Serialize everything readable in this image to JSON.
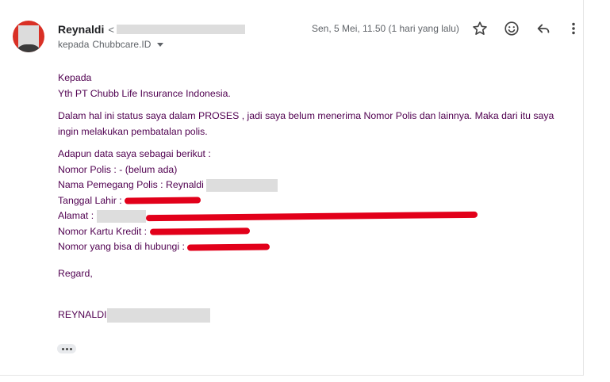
{
  "header": {
    "sender_name": "Reynaldi",
    "sender_email_open": "<",
    "recipient_prefix": "kepada",
    "recipient_name": "Chubbcare.ID",
    "timestamp": "Sen, 5 Mei, 11.50 (1 hari yang lalu)"
  },
  "icons": {
    "star": "star-icon",
    "emoji": "smiley-icon",
    "reply": "reply-icon",
    "more": "more-vert-icon",
    "expand": "ellipsis-icon"
  },
  "body": {
    "greeting_1": "Kepada",
    "greeting_2": "Yth  PT Chubb Life Insurance Indonesia.",
    "paragraph_1_line_1": "Dalam hal ini status saya dalam PROSES , jadi saya belum menerima Nomor Polis dan lainnya. Maka dari itu saya",
    "paragraph_1_line_2": "ingin melakukan pembatalan polis.",
    "data_intro": "Adapun data saya sebagai berikut :",
    "nomor_polis": "Nomor Polis : - (belum ada)",
    "nama_pemegang": "Nama Pemegang Polis : Reynaldi",
    "tanggal_lahir": "Tanggal Lahir :",
    "alamat": "Alamat :",
    "nomor_kartu": "Nomor Kartu Kredit :",
    "nomor_hp": "Nomor yang bisa di hubungi :",
    "closing": "Regard,",
    "signature": "REYNALDI"
  },
  "colors": {
    "body_text": "#500050",
    "redaction_red": "#e2001a",
    "redaction_gray": "#dddddd",
    "avatar_bg": "#d93025"
  }
}
